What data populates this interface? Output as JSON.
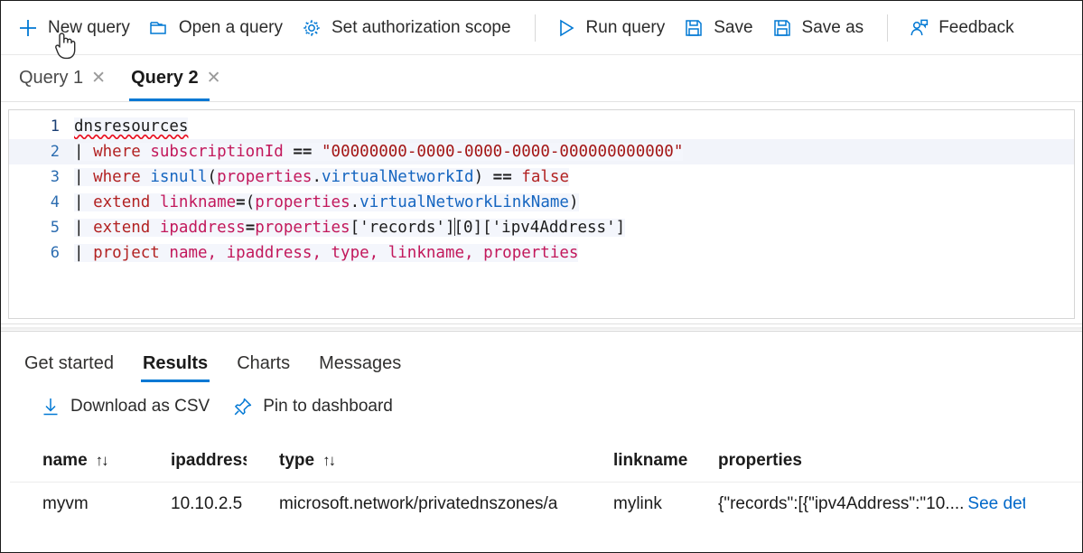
{
  "toolbar": {
    "items": [
      {
        "label": "New query",
        "icon": "plus-icon"
      },
      {
        "label": "Open a query",
        "icon": "folder-icon"
      },
      {
        "label": "Set authorization scope",
        "icon": "gear-icon"
      },
      {
        "label": "Run query",
        "icon": "play-icon"
      },
      {
        "label": "Save",
        "icon": "save-icon"
      },
      {
        "label": "Save as",
        "icon": "save-as-icon"
      },
      {
        "label": "Feedback",
        "icon": "feedback-person-icon"
      }
    ]
  },
  "query_tabs": {
    "items": [
      {
        "label": "Query 1",
        "active": false,
        "close": "✕"
      },
      {
        "label": "Query 2",
        "active": true,
        "close": "✕"
      }
    ]
  },
  "editor": {
    "line_numbers": [
      "1",
      "2",
      "3",
      "4",
      "5",
      "6"
    ],
    "query_text": "dnsresources\n| where subscriptionId == \"00000000-0000-0000-0000-000000000000\"\n| where isnull(properties.virtualNetworkId) == false\n| extend linkname=(properties.virtualNetworkLinkName)\n| extend ipaddress=properties['records'][0]['ipv4Address']\n| project name, ipaddress, type, linkname, properties",
    "lines": [
      {
        "n": "1",
        "table": "dnsresources"
      },
      {
        "n": "2",
        "pipe": "|",
        "kw": "where",
        "field": "subscriptionId",
        "op": "==",
        "str": "\"00000000-0000-0000-0000-000000000000\""
      },
      {
        "n": "3",
        "pipe": "|",
        "kw": "where",
        "fn": "isnull",
        "open": "(",
        "obj": "properties",
        "dot": ".",
        "prop": "virtualNetworkId",
        "close": ")",
        "op": "==",
        "val": "false"
      },
      {
        "n": "4",
        "pipe": "|",
        "kw": "extend",
        "field": "linkname",
        "eq": "=",
        "open": "(",
        "obj": "properties",
        "dot": ".",
        "prop": "virtualNetworkLinkName",
        "close": ")"
      },
      {
        "n": "5",
        "pipe": "|",
        "kw": "extend",
        "field": "ipaddress",
        "eq": "=",
        "obj": "properties",
        "idx1": "['records']",
        "idx2": "[0]",
        "idx3": "['ipv4Address']"
      },
      {
        "n": "6",
        "pipe": "|",
        "kw": "project",
        "fields": "name, ipaddress, type, linkname, properties"
      }
    ]
  },
  "results": {
    "tabs": [
      {
        "label": "Get started",
        "active": false
      },
      {
        "label": "Results",
        "active": true
      },
      {
        "label": "Charts",
        "active": false
      },
      {
        "label": "Messages",
        "active": false
      }
    ],
    "actions": [
      {
        "label": "Download as CSV",
        "icon": "download-icon"
      },
      {
        "label": "Pin to dashboard",
        "icon": "pin-icon"
      }
    ],
    "table": {
      "columns": [
        {
          "key": "name",
          "label": "name",
          "sortable": true,
          "sort_glyph": "↑↓"
        },
        {
          "key": "ipaddress",
          "label": "ipaddress",
          "sortable": false,
          "sort_glyph": ""
        },
        {
          "key": "type",
          "label": "type",
          "sortable": true,
          "sort_glyph": "↑↓"
        },
        {
          "key": "linkname",
          "label": "linkname",
          "sortable": false,
          "sort_glyph": ""
        },
        {
          "key": "properties",
          "label": "properties",
          "sortable": false,
          "sort_glyph": ""
        }
      ],
      "rows": [
        {
          "name": "myvm",
          "ipaddress": "10.10.2.5",
          "type": "microsoft.network/privatednszones/a",
          "linkname": "mylink",
          "properties": "{\"records\":[{\"ipv4Address\":\"10....",
          "details_link": "See details"
        }
      ]
    }
  },
  "colors": {
    "accent": "#0078d4",
    "link": "#0068c9",
    "text": "#1b1b1b",
    "muted": "#4a4a4a",
    "border": "#e3e3e3",
    "editor_keyword": "#b22222",
    "editor_field": "#c2185b",
    "editor_function": "#1565c0",
    "editor_string": "#a31515",
    "error_squiggle": "#e81123",
    "current_line_bg": "#f2f4fa"
  }
}
